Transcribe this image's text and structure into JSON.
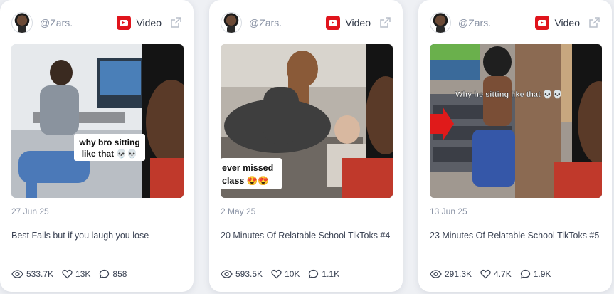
{
  "cards": [
    {
      "handle": "@Zars.",
      "source": "Video",
      "caption": "why bro sitting like that 💀💀",
      "date": "27 Jun 25",
      "title": "Best Fails but if you laugh you lose",
      "views": "533.7K",
      "likes": "13K",
      "comments": "858"
    },
    {
      "handle": "@Zars.",
      "source": "Video",
      "caption": "ever missed class 😍😍",
      "date": "2 May 25",
      "title": "20 Minutes Of Relatable School TikToks #4",
      "views": "593.5K",
      "likes": "10K",
      "comments": "1.1K"
    },
    {
      "handle": "@Zars.",
      "source": "Video",
      "caption": "Why he sitting like that 💀💀",
      "date": "13 Jun 25",
      "title": "23 Minutes Of Relatable School TikToks #5",
      "views": "291.3K",
      "likes": "4.7K",
      "comments": "1.9K"
    }
  ],
  "colors": {
    "youtube_red": "#e0141c",
    "muted_text": "#8a93a5",
    "body_text": "#3b4354"
  },
  "icons": [
    "youtube-icon",
    "external-link-icon",
    "eye-icon",
    "heart-icon",
    "comment-icon"
  ]
}
